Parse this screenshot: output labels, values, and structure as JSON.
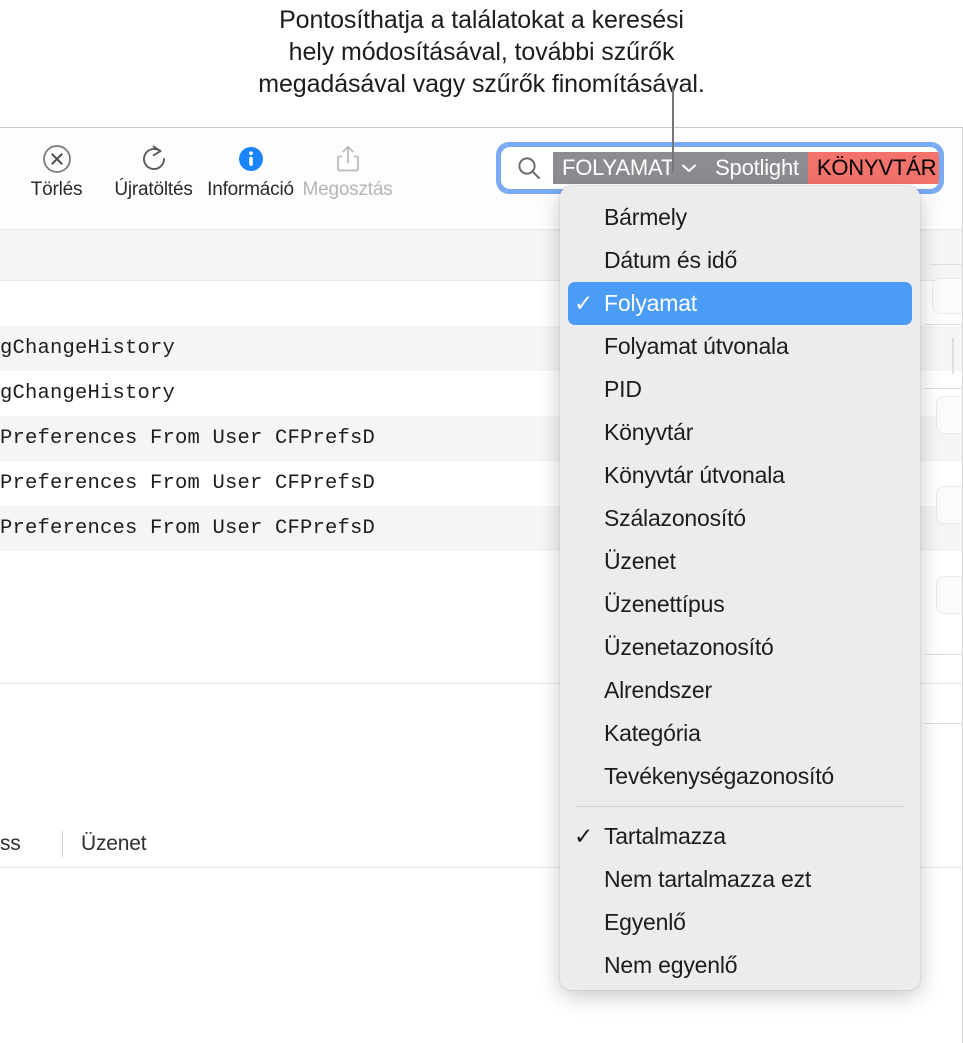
{
  "callout": {
    "lines": [
      "Pontosíthatja a találatokat a keresési",
      "hely módosításával, további szűrők",
      "megadásával vagy szűrők finomításával."
    ]
  },
  "toolbar": {
    "items": [
      {
        "label": "Törlés",
        "icon": "clear-circle-x-icon",
        "disabled": false
      },
      {
        "label": "Újratöltés",
        "icon": "reload-arrow-icon",
        "disabled": false
      },
      {
        "label": "Információ",
        "icon": "info-circle-icon",
        "disabled": false
      },
      {
        "label": "Megosztás",
        "icon": "share-upload-icon",
        "disabled": true
      }
    ]
  },
  "search": {
    "icon": "search-magnifier-icon",
    "focused": true,
    "focus_ring_color": "#78abf4",
    "tokens": [
      {
        "label": "FOLYAMAT",
        "style": "gray",
        "has_chevron": true,
        "color": "#8c8c91",
        "text_color": "#ffffff"
      },
      {
        "label": "Spotlight",
        "style": "gray",
        "has_chevron": false,
        "color": "#8c8c91",
        "text_color": "#ffffff"
      },
      {
        "label": "KÖNYVTÁR",
        "style": "red",
        "has_chevron": false,
        "color": "#f3726c",
        "text_color": "#000000"
      }
    ]
  },
  "log_table": {
    "columns": [
      {
        "label": "ss"
      },
      {
        "label": "Üzenet"
      }
    ],
    "rows": [
      {
        "text": "gChangeHistory",
        "alt": true
      },
      {
        "text": "gChangeHistory",
        "alt": false
      },
      {
        "text": "Preferences From User CFPrefsD",
        "alt": true
      },
      {
        "text": "Preferences From User CFPrefsD",
        "alt": false
      },
      {
        "text": "Preferences From User CFPrefsD",
        "alt": true
      }
    ]
  },
  "menu": {
    "selected_color": "#4a9cf6",
    "background": "#ececec",
    "groups": [
      {
        "items": [
          {
            "label": "Bármely",
            "checked": false,
            "selected": false
          },
          {
            "label": "Dátum és idő",
            "checked": false,
            "selected": false
          },
          {
            "label": "Folyamat",
            "checked": true,
            "selected": true
          },
          {
            "label": "Folyamat útvonala",
            "checked": false,
            "selected": false
          },
          {
            "label": "PID",
            "checked": false,
            "selected": false
          },
          {
            "label": "Könyvtár",
            "checked": false,
            "selected": false
          },
          {
            "label": "Könyvtár útvonala",
            "checked": false,
            "selected": false
          },
          {
            "label": "Szálazonosító",
            "checked": false,
            "selected": false
          },
          {
            "label": "Üzenet",
            "checked": false,
            "selected": false
          },
          {
            "label": "Üzenettípus",
            "checked": false,
            "selected": false
          },
          {
            "label": "Üzenetazonosító",
            "checked": false,
            "selected": false
          },
          {
            "label": "Alrendszer",
            "checked": false,
            "selected": false
          },
          {
            "label": "Kategória",
            "checked": false,
            "selected": false
          },
          {
            "label": "Tevékenységazonosító",
            "checked": false,
            "selected": false
          }
        ]
      },
      {
        "items": [
          {
            "label": "Tartalmazza",
            "checked": true,
            "selected": false
          },
          {
            "label": "Nem tartalmazza ezt",
            "checked": false,
            "selected": false
          },
          {
            "label": "Egyenlő",
            "checked": false,
            "selected": false
          },
          {
            "label": "Nem egyenlő",
            "checked": false,
            "selected": false
          }
        ]
      }
    ],
    "checkmark_glyph": "✓"
  }
}
